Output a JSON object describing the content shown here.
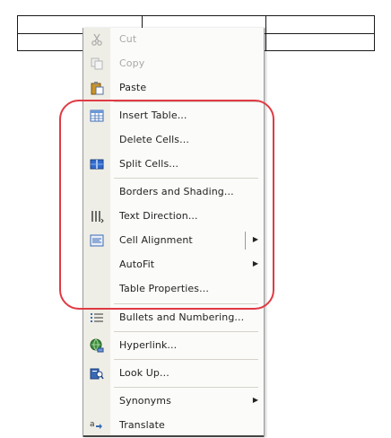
{
  "context_menu": {
    "items": [
      {
        "label": "Cut",
        "icon": "scissors-icon",
        "enabled": false
      },
      {
        "label": "Copy",
        "icon": "copy-icon",
        "enabled": false
      },
      {
        "label": "Paste",
        "icon": "paste-icon",
        "enabled": true
      },
      {
        "label": "Insert Table...",
        "icon": "insert-table-icon",
        "enabled": true
      },
      {
        "label": "Delete Cells...",
        "icon": "",
        "enabled": true
      },
      {
        "label": "Split Cells...",
        "icon": "split-cells-icon",
        "enabled": true
      },
      {
        "label": "Borders and Shading...",
        "icon": "",
        "enabled": true
      },
      {
        "label": "Text Direction...",
        "icon": "text-direction-icon",
        "enabled": true
      },
      {
        "label": "Cell Alignment",
        "icon": "cell-alignment-icon",
        "enabled": true,
        "submenu": true
      },
      {
        "label": "AutoFit",
        "icon": "",
        "enabled": true,
        "submenu": true
      },
      {
        "label": "Table Properties...",
        "icon": "",
        "enabled": true
      },
      {
        "label": "Bullets and Numbering...",
        "icon": "bullets-icon",
        "enabled": true
      },
      {
        "label": "Hyperlink...",
        "icon": "hyperlink-icon",
        "enabled": true
      },
      {
        "label": "Look Up...",
        "icon": "lookup-icon",
        "enabled": true
      },
      {
        "label": "Synonyms",
        "icon": "",
        "enabled": true,
        "submenu": true
      },
      {
        "label": "Translate",
        "icon": "translate-icon",
        "enabled": true
      }
    ]
  },
  "colors": {
    "highlight": "#e03a44",
    "menu_background": "#fbfbf9",
    "gutter": "#efeee6"
  }
}
